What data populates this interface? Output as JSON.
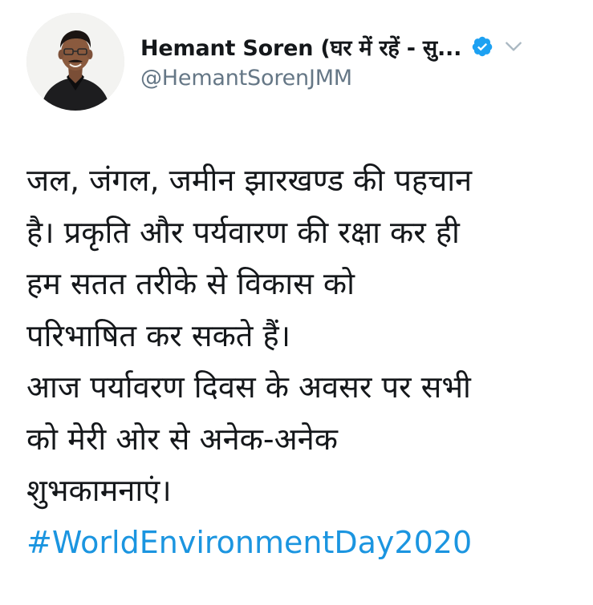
{
  "tweet": {
    "author": {
      "display_name": "Hemant Soren (घर में रहें - सु...",
      "handle": "@HemantSorenJMM",
      "avatar_icon": "user-avatar-photo",
      "verified_icon": "verified-badge-icon",
      "menu_icon": "chevron-down-icon"
    },
    "text_lines": [
      "जल, जंगल, जमीन झारखण्ड की पहचान",
      "है। प्रकृति और पर्यवारण की रक्षा कर ही",
      "हम सतत तरीके से विकास को",
      "परिभाषित कर सकते हैं।",
      "आज पर्यावरण दिवस के अवसर पर सभी",
      "को मेरी ओर से अनेक-अनेक",
      "शुभकामनाएं।"
    ],
    "hashtag": "#WorldEnvironmentDay2020"
  },
  "colors": {
    "text": "#14171a",
    "secondary_text": "#657786",
    "link": "#1b95e0",
    "verified_badge": "#1da1f2",
    "chevron": "#aab8c2"
  }
}
